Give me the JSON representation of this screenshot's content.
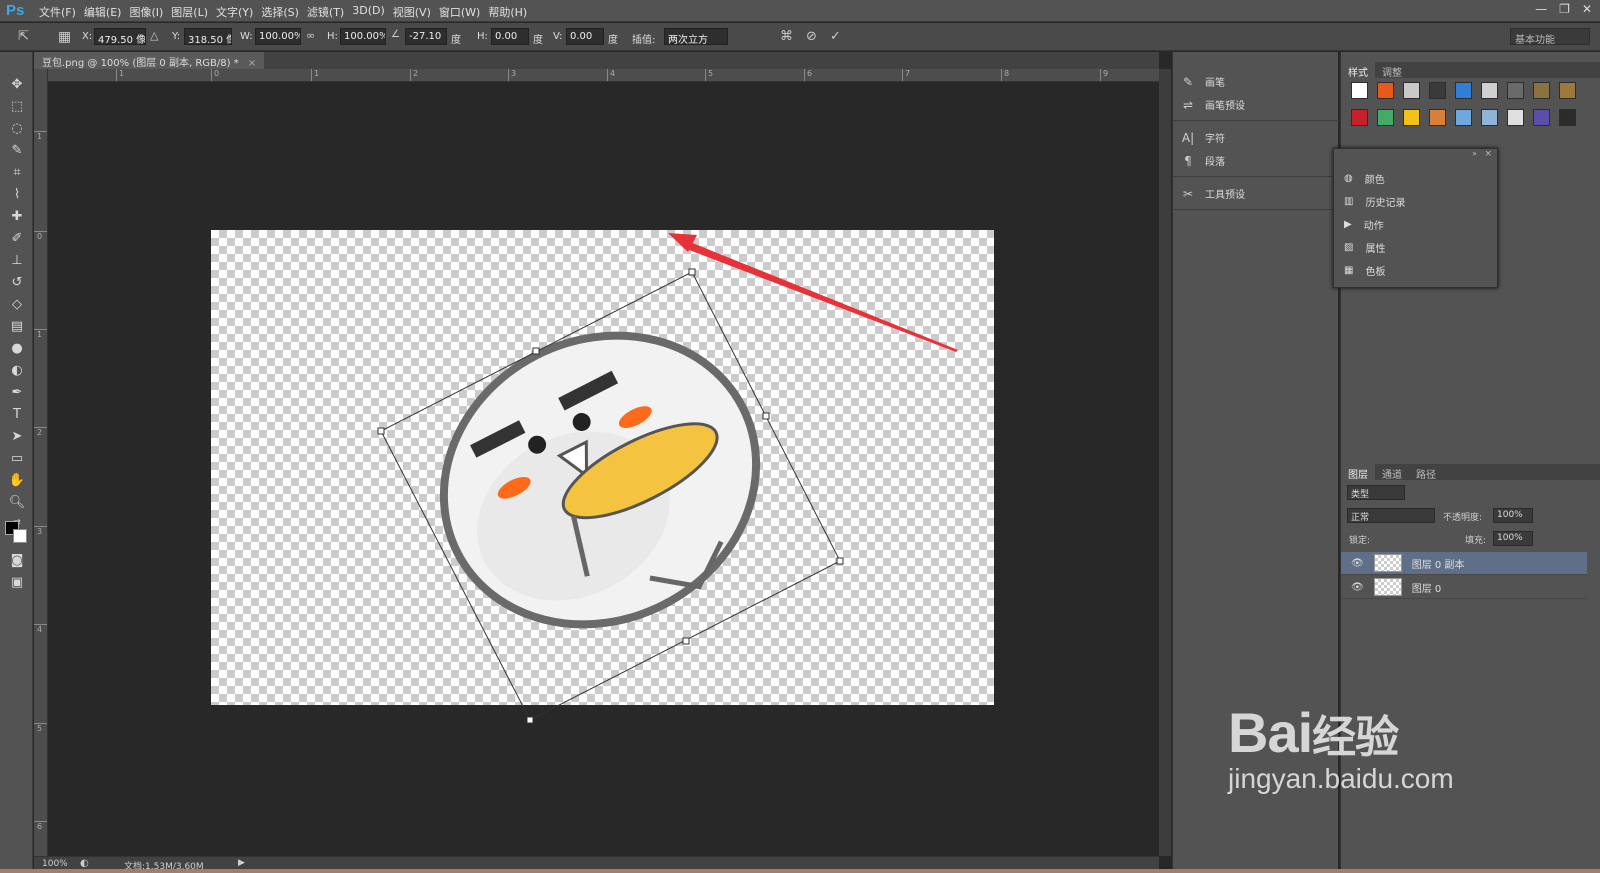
{
  "app": {
    "logo": "Ps",
    "menus": [
      "文件(F)",
      "编辑(E)",
      "图像(I)",
      "图层(L)",
      "文字(Y)",
      "选择(S)",
      "滤镜(T)",
      "3D(D)",
      "视图(V)",
      "窗口(W)",
      "帮助(H)"
    ],
    "window_controls": [
      "—",
      "❐",
      "✕"
    ]
  },
  "options": {
    "x_label": "X:",
    "x_value": "479.50 像",
    "y_label": "Y:",
    "y_value": "318.50 像",
    "w_label": "W:",
    "w_value": "100.00%",
    "h_label": "H:",
    "h_value": "100.00%",
    "angle_value": "-27.10",
    "angle_unit": "度",
    "hskew_label": "H:",
    "hskew_value": "0.00",
    "hskew_unit": "度",
    "vskew_label": "V:",
    "vskew_value": "0.00",
    "vskew_unit": "度",
    "interp_label": "插值:",
    "interp_value": "两次立方",
    "workspace": "基本功能"
  },
  "document": {
    "tab_title": "豆包.png @ 100% (图层 0 副本, RGB/8) *",
    "zoom": "100%",
    "doc_size": "文档:1.53M/3.60M",
    "ruler_h": [
      "1",
      "0",
      "1",
      "2",
      "3",
      "4",
      "5",
      "6",
      "7",
      "8",
      "9"
    ],
    "ruler_v": [
      "1",
      "0",
      "1",
      "2",
      "3",
      "4",
      "5",
      "6"
    ]
  },
  "middock": {
    "items": [
      {
        "icon": "brush-icon",
        "label": "画笔"
      },
      {
        "icon": "brush-preset-icon",
        "label": "画笔预设"
      },
      {
        "icon": "character-icon",
        "label": "字符"
      },
      {
        "icon": "paragraph-icon",
        "label": "段落"
      },
      {
        "icon": "tool-preset-icon",
        "label": "工具预设"
      }
    ]
  },
  "styles_panel": {
    "tabs": [
      "样式",
      "调整"
    ],
    "swatch_colors": [
      "#ffffff",
      "#e85a1a",
      "#c9c9c9",
      "#3a3a3a",
      "#2f7fd6",
      "#d0d0d0",
      "#6a6a6a",
      "#8a7340",
      "#9c7b3a",
      "#c8202a",
      "#44aa66",
      "#f2c21a",
      "#d97f3a",
      "#6fa8dc",
      "#8fb4d8",
      "#e0e0e0",
      "#5a4fa8",
      "#2b2b2b"
    ]
  },
  "float_panel": {
    "items": [
      {
        "icon": "color-icon",
        "label": "颜色"
      },
      {
        "icon": "history-icon",
        "label": "历史记录"
      },
      {
        "icon": "actions-icon",
        "label": "动作"
      },
      {
        "icon": "properties-icon",
        "label": "属性"
      },
      {
        "icon": "swatches-icon",
        "label": "色板"
      }
    ]
  },
  "layers_panel": {
    "tabs": [
      "图层",
      "通道",
      "路径"
    ],
    "filter": "类型",
    "blend_mode": "正常",
    "opacity_label": "不透明度:",
    "opacity": "100%",
    "lock_label": "锁定:",
    "fill_label": "填充:",
    "fill": "100%",
    "layers": [
      {
        "name": "图层 0 副本",
        "selected": true
      },
      {
        "name": "图层 0",
        "selected": false
      }
    ]
  },
  "watermark": {
    "brand": "Bai",
    "brand2": "经验",
    "url": "jingyan.baidu.com"
  }
}
